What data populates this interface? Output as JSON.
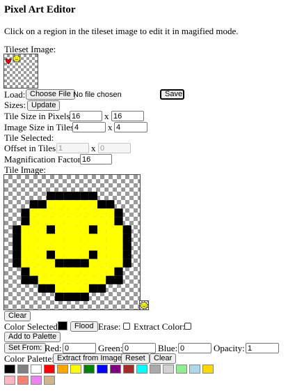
{
  "title": "Pixel Art Editor",
  "instructions": "Click on a region in the tileset image to edit it in magified mode.",
  "tileset": {
    "label": "Tileset Image:"
  },
  "load": {
    "label": "Load:",
    "choose_file": "Choose File",
    "no_file": "No file chosen",
    "save": "Save"
  },
  "sizes": {
    "label": "Sizes:",
    "update": "Update"
  },
  "tile_size": {
    "label": "Tile Size in Pixels:",
    "width": "16",
    "sep": "x",
    "height": "16"
  },
  "image_size": {
    "label": "Image Size in Tiles:",
    "width": "4",
    "sep": "x",
    "height": "4"
  },
  "tile_selected": {
    "label": "Tile Selected:"
  },
  "offset": {
    "label": "Offset in Tiles:",
    "x": "1",
    "sep": "x",
    "y": "0"
  },
  "magnification": {
    "label": "Magnification Factor:",
    "value": "16"
  },
  "tile_image": {
    "label": "Tile Image:"
  },
  "clear_tile": "Clear",
  "color_selected": {
    "label": "Color Selected:",
    "color": "#000000",
    "flood": "Flood",
    "erase": "Erase:",
    "extract": "Extract Color:"
  },
  "add_palette": "Add to Palette",
  "rgba": {
    "set_from": "Set From:",
    "red_label": "Red:",
    "red": "0",
    "green_label": "Green:",
    "green": "0",
    "blue_label": "Blue:",
    "blue": "0",
    "opacity_label": "Opacity:",
    "opacity": "1"
  },
  "palette": {
    "label": "Color Palette:",
    "extract": "Extract from Image",
    "reset": "Reset",
    "clear": "Clear",
    "colors": [
      "#000000",
      "#808080",
      "#ffffff",
      "#ff0000",
      "#ffa500",
      "#ffff00",
      "#008000",
      "#0000ff",
      "#800080",
      "#a52a2a",
      "#00ffff",
      "#a9a9a9",
      "#d3d3d3",
      "#90ee90",
      "#add8e6",
      "#ffd700",
      "#ffb6c1",
      "#fa8072",
      "#ee82ee",
      "#d2b48c"
    ]
  },
  "smiley": {
    "fill": "#ffff00",
    "outline": "#000000",
    "pixels": [
      "................",
      "................",
      ".....######.....",
      "...##yyyyyy##...",
      "..#yyyyyyyyyy#..",
      "..#yyyyyyyyyy#..",
      ".#yyy#yyyy#yyy#.",
      ".#yyyyyyyyyyyy#.",
      ".#yyyyyyyyyyyy#.",
      ".#yyy#yyyy#yyy#.",
      ".#yyyy####yyyy#.",
      "..#yyyyyyyyyy#..",
      "..##yyyyyyyy##..",
      "....##yyyy##....",
      "......####......",
      "................"
    ]
  },
  "heart_color": "#ff0000"
}
